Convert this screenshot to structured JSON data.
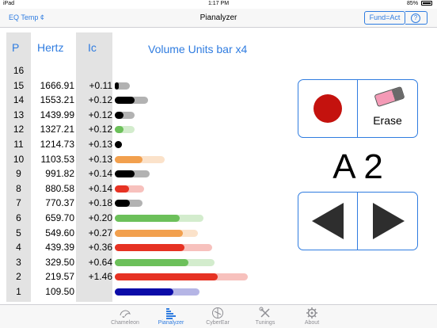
{
  "status_bar": {
    "device": "iPad",
    "time": "1:17 PM",
    "battery": "85%"
  },
  "nav": {
    "left_label": "EQ Temp ¢",
    "title": "Pianalyzer",
    "fund_label": "Fund=Act",
    "help_label": "?"
  },
  "table": {
    "headers": {
      "p": "P",
      "hertz": "Hertz",
      "ic": "Ic"
    },
    "title": "Volume Units bar x4",
    "rows": [
      {
        "p": "16",
        "hz": "",
        "ic": "",
        "bar": 0,
        "bar_light": 0,
        "color": ""
      },
      {
        "p": "15",
        "hz": "1666.91",
        "ic": "+0.11",
        "bar": 0.03,
        "bar_light": 0.11,
        "color": "#000000"
      },
      {
        "p": "14",
        "hz": "1553.21",
        "ic": "+0.12",
        "bar": 0.14,
        "bar_light": 0.24,
        "color": "#000000"
      },
      {
        "p": "13",
        "hz": "1439.99",
        "ic": "+0.12",
        "bar": 0.06,
        "bar_light": 0.14,
        "color": "#000000"
      },
      {
        "p": "12",
        "hz": "1327.21",
        "ic": "+0.12",
        "bar": 0.06,
        "bar_light": 0.14,
        "color": "#6cc05a"
      },
      {
        "p": "11",
        "hz": "1214.73",
        "ic": "+0.13",
        "bar": 0.05,
        "bar_light": 0.05,
        "color": "#000000"
      },
      {
        "p": "10",
        "hz": "1103.53",
        "ic": "+0.13",
        "bar": 0.2,
        "bar_light": 0.36,
        "color": "#f2a04e"
      },
      {
        "p": "9",
        "hz": "991.82",
        "ic": "+0.14",
        "bar": 0.14,
        "bar_light": 0.25,
        "color": "#000000"
      },
      {
        "p": "8",
        "hz": "880.58",
        "ic": "+0.14",
        "bar": 0.1,
        "bar_light": 0.21,
        "color": "#e63223"
      },
      {
        "p": "7",
        "hz": "770.37",
        "ic": "+0.18",
        "bar": 0.11,
        "bar_light": 0.2,
        "color": "#000000"
      },
      {
        "p": "6",
        "hz": "659.70",
        "ic": "+0.20",
        "bar": 0.47,
        "bar_light": 0.64,
        "color": "#6cc05a"
      },
      {
        "p": "5",
        "hz": "549.60",
        "ic": "+0.27",
        "bar": 0.49,
        "bar_light": 0.6,
        "color": "#f2a04e"
      },
      {
        "p": "4",
        "hz": "439.39",
        "ic": "+0.36",
        "bar": 0.5,
        "bar_light": 0.7,
        "color": "#e63223"
      },
      {
        "p": "3",
        "hz": "329.50",
        "ic": "+0.64",
        "bar": 0.53,
        "bar_light": 0.72,
        "color": "#6cc05a"
      },
      {
        "p": "2",
        "hz": "219.57",
        "ic": "+1.46",
        "bar": 0.74,
        "bar_light": 0.96,
        "color": "#e63223"
      },
      {
        "p": "1",
        "hz": "109.50",
        "ic": "",
        "bar": 0.42,
        "bar_light": 0.61,
        "color": "#0b0ba8"
      }
    ]
  },
  "controls": {
    "record_icon": "record-dot",
    "erase_label": "Erase",
    "note": "A 2",
    "prev_icon": "left-triangle",
    "next_icon": "right-triangle"
  },
  "tabs": [
    {
      "label": "Chameleon",
      "icon": "chameleon-icon",
      "active": false
    },
    {
      "label": "Pianalyzer",
      "icon": "bars-icon",
      "active": true
    },
    {
      "label": "CyberEar",
      "icon": "ear-icon",
      "active": false
    },
    {
      "label": "Tunings",
      "icon": "tools-icon",
      "active": false
    },
    {
      "label": "About",
      "icon": "gear-icon",
      "active": false
    }
  ]
}
